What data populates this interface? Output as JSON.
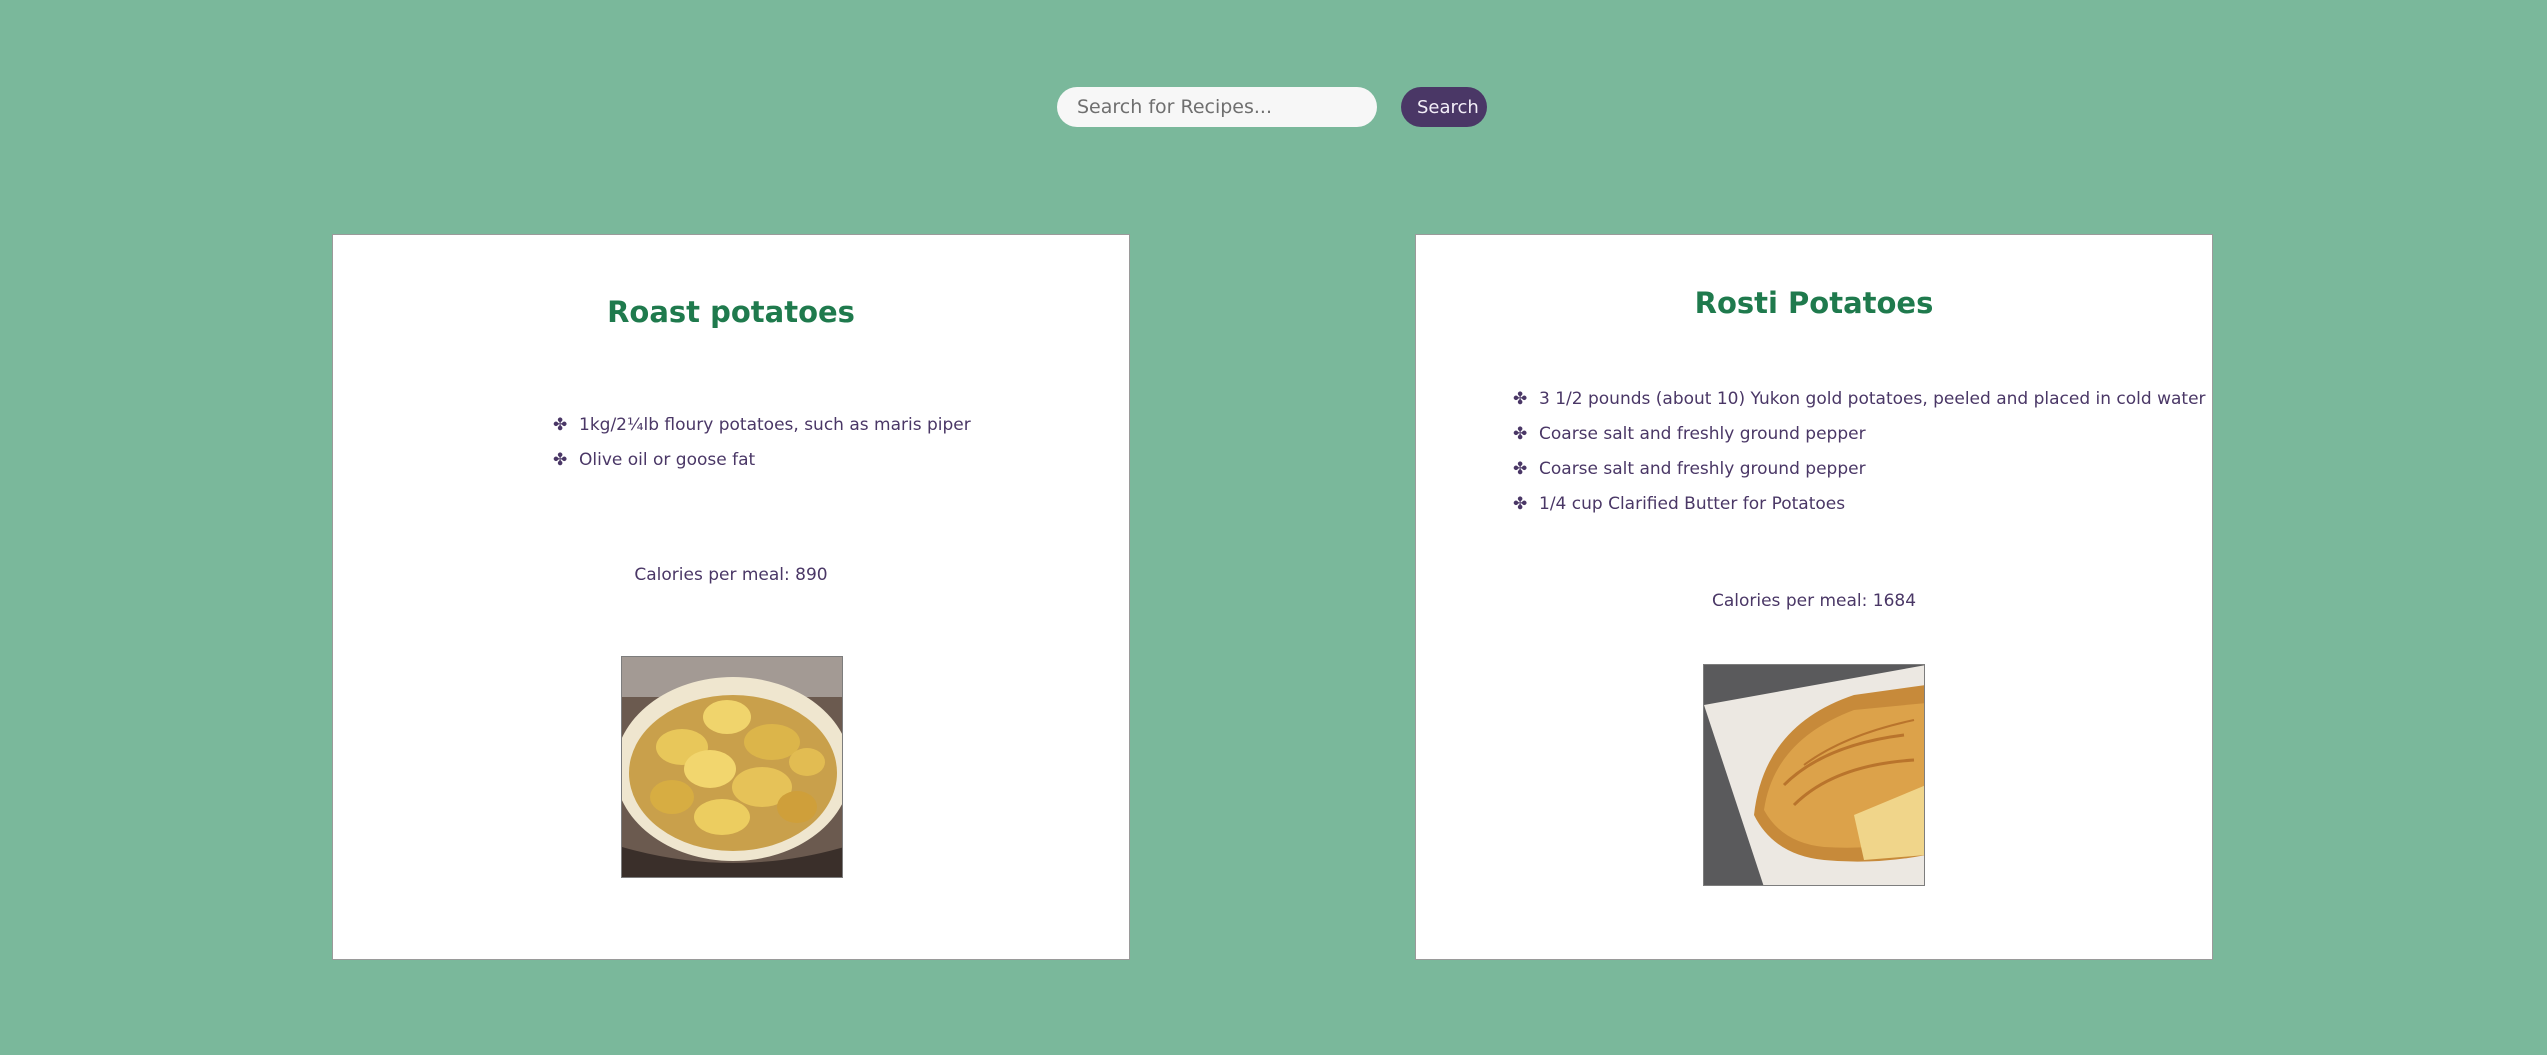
{
  "search": {
    "placeholder": "Search for Recipes...",
    "value": "",
    "button_label": "Search"
  },
  "recipes": [
    {
      "title": "Roast potatoes",
      "ingredients": [
        "1kg/2¼lb floury potatoes, such as maris piper",
        "Olive oil or goose fat"
      ],
      "calories": "Calories per meal: 890",
      "image": "roast-potatoes-photo"
    },
    {
      "title": "Rosti Potatoes",
      "ingredients": [
        "3 1/2 pounds (about 10) Yukon gold potatoes, peeled and placed in cold water",
        "Coarse salt and freshly ground pepper",
        "Coarse salt and freshly ground pepper",
        "1/4 cup Clarified Butter for Potatoes"
      ],
      "calories": "Calories per meal: 1684",
      "image": "rosti-potatoes-photo"
    }
  ],
  "icons": {
    "bullet": "four-leaf-bullet-icon"
  },
  "colors": {
    "background": "#7ab89b",
    "title": "#1f7a4d",
    "text": "#4a3766",
    "button": "#4a3766"
  }
}
